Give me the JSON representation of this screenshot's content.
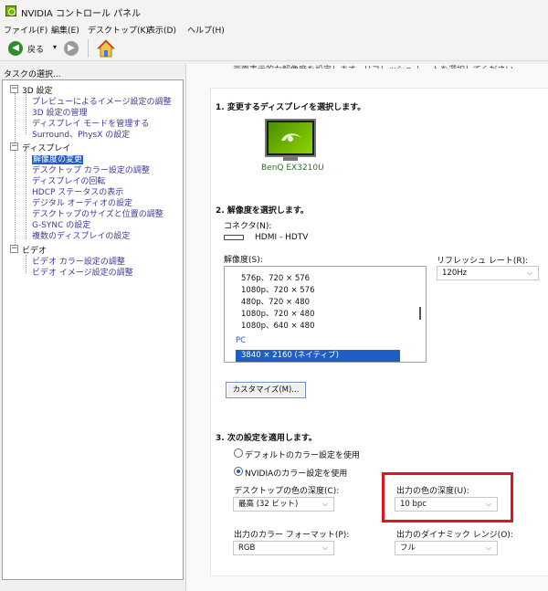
{
  "window": {
    "title": "NVIDIA コントロール パネル"
  },
  "menu": [
    "ファイル(F)",
    "編集(E)",
    "デスクトップ(K)",
    "表示(D)",
    "ヘルプ(H)"
  ],
  "toolbar": {
    "back_label": "戻る",
    "back_arrow": "◀",
    "back_dropdown": "▾",
    "forward_arrow": "▶"
  },
  "sidebar": {
    "heading": "タスクの選択...",
    "groups": [
      {
        "label": "3D 設定",
        "expander": "−",
        "items": [
          "プレビューによるイメージ設定の調整",
          "3D 設定の管理",
          "ディスプレイ モードを管理する",
          "Surround、PhysX の設定"
        ]
      },
      {
        "label": "ディスプレイ",
        "expander": "−",
        "items": [
          "解像度の変更",
          "デスクトップ カラー設定の調整",
          "ディスプレイの回転",
          "HDCP ステータスの表示",
          "デジタル オーディオの設定",
          "デスクトップのサイズと位置の調整",
          "G-SYNC の設定",
          "複数のディスプレイの設定"
        ]
      },
      {
        "label": "ビデオ",
        "expander": "−",
        "items": [
          "ビデオ カラー設定の調整",
          "ビデオ イメージ設定の調整"
        ]
      }
    ]
  },
  "content": {
    "top_cut_text": "画面表示的な解像度を設定します。リフレッシュ レートを選択してください",
    "section1_title": "1. 変更するディスプレイを選択します。",
    "monitor_label": "BenQ EX3210U",
    "section2_title": "2. 解像度を選択します。",
    "connector_label": "コネクタ(N):",
    "connector_value": "HDMI - HDTV",
    "resolution_label": "解像度(S):",
    "resolution_items": [
      "576p、720 × 576",
      "1080p、720 × 576",
      "480p、720 × 480",
      "1080p、720 × 480",
      "1080p、640 × 480"
    ],
    "resolution_group_pc": "PC",
    "resolution_selected": "3840 × 2160 (ネイティブ)",
    "refresh_label": "リフレッシュ レート(R):",
    "refresh_value": "120Hz",
    "customize_button": "カスタマイズ(M)...",
    "section3_title": "3. 次の設定を適用します。",
    "radio_default": "デフォルトのカラー設定を使用",
    "radio_nvidia": "NVIDIAのカラー設定を使用",
    "desktop_depth_label": "デスクトップの色の深度(C):",
    "desktop_depth_value": "最高 (32 ビット)",
    "output_depth_label": "出力の色の深度(U):",
    "output_depth_value": "10 bpc",
    "color_format_label": "出力のカラー フォーマット(P):",
    "color_format_value": "RGB",
    "dynamic_range_label": "出力のダイナミック レンジ(O):",
    "dynamic_range_value": "フル",
    "dropdown_arrow": "⌵"
  },
  "colors": {
    "accent": "#1f5fc4",
    "nvidia_green": "#76b900",
    "highlight": "#e3151a"
  }
}
